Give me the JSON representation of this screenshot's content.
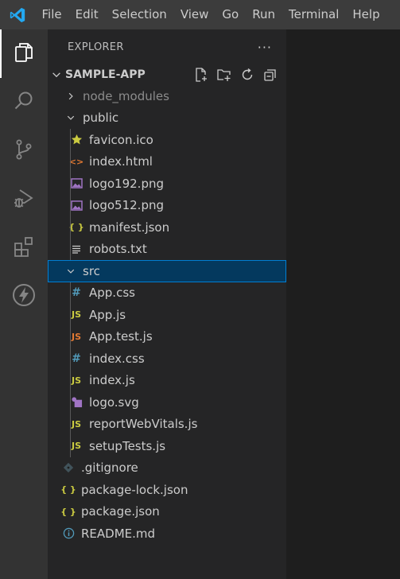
{
  "menu": [
    "File",
    "Edit",
    "Selection",
    "View",
    "Go",
    "Run",
    "Terminal",
    "Help"
  ],
  "activity_bar": [
    {
      "name": "explorer",
      "active": true
    },
    {
      "name": "search",
      "active": false
    },
    {
      "name": "source-control",
      "active": false
    },
    {
      "name": "run-and-debug",
      "active": false
    },
    {
      "name": "extensions",
      "active": false
    },
    {
      "name": "thunder",
      "active": false
    }
  ],
  "sidebar": {
    "title": "EXPLORER",
    "more": "···",
    "section": {
      "title": "SAMPLE-APP",
      "actions": [
        "new-file-icon",
        "new-folder-icon",
        "refresh-icon",
        "collapse-all-icon"
      ]
    },
    "tree": [
      {
        "label": "node_modules",
        "type": "folder",
        "expanded": false,
        "icon": "chevron-right-icon",
        "dim": true
      },
      {
        "label": "public",
        "type": "folder",
        "expanded": true,
        "icon": "chevron-down-icon"
      },
      {
        "label": "favicon.ico",
        "type": "file",
        "icon": "star-icon",
        "color": "#cbcb41"
      },
      {
        "label": "index.html",
        "type": "file",
        "icon": "html-icon",
        "color": "#e37933"
      },
      {
        "label": "logo192.png",
        "type": "file",
        "icon": "image-icon",
        "color": "#a074c4"
      },
      {
        "label": "logo512.png",
        "type": "file",
        "icon": "image-icon",
        "color": "#a074c4"
      },
      {
        "label": "manifest.json",
        "type": "file",
        "icon": "json-icon",
        "color": "#cbcb41"
      },
      {
        "label": "robots.txt",
        "type": "file",
        "icon": "text-file-icon",
        "color": "#cccccc"
      },
      {
        "label": "src",
        "type": "folder",
        "expanded": true,
        "icon": "chevron-down-icon",
        "selected": true
      },
      {
        "label": "App.css",
        "type": "file",
        "icon": "css-icon",
        "color": "#519aba"
      },
      {
        "label": "App.js",
        "type": "file",
        "icon": "js-icon",
        "color": "#cbcb41"
      },
      {
        "label": "App.test.js",
        "type": "file",
        "icon": "js-test-icon",
        "color": "#e37933"
      },
      {
        "label": "index.css",
        "type": "file",
        "icon": "css-icon",
        "color": "#519aba"
      },
      {
        "label": "index.js",
        "type": "file",
        "icon": "js-icon",
        "color": "#cbcb41"
      },
      {
        "label": "logo.svg",
        "type": "file",
        "icon": "svg-icon",
        "color": "#a074c4"
      },
      {
        "label": "reportWebVitals.js",
        "type": "file",
        "icon": "js-icon",
        "color": "#cbcb41"
      },
      {
        "label": "setupTests.js",
        "type": "file",
        "icon": "js-icon",
        "color": "#cbcb41"
      },
      {
        "label": ".gitignore",
        "type": "file",
        "icon": "git-icon",
        "color": "#41535b"
      },
      {
        "label": "package-lock.json",
        "type": "file",
        "icon": "json-icon",
        "color": "#cbcb41"
      },
      {
        "label": "package.json",
        "type": "file",
        "icon": "json-icon",
        "color": "#cbcb41"
      },
      {
        "label": "README.md",
        "type": "file",
        "icon": "info-icon",
        "color": "#519aba"
      }
    ]
  },
  "icon_glyphs": {
    "json": "{ }",
    "js": "JS",
    "css": "#",
    "html": "<>"
  }
}
